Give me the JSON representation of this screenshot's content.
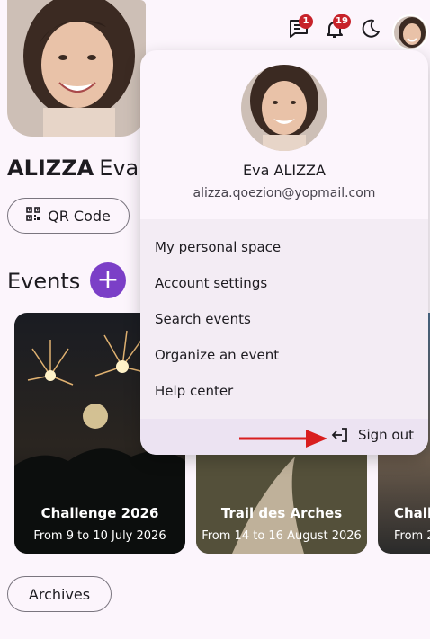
{
  "profile": {
    "last_name": "ALIZZA",
    "first_name": "Eva"
  },
  "qr_button": {
    "label": "QR Code"
  },
  "events": {
    "title": "Events",
    "add_label": "+",
    "cards": [
      {
        "title": "Challenge 2026",
        "date": "From 9 to 10 July 2026"
      },
      {
        "title": "Trail des Arches",
        "date": "From 14 to 16 August 2026"
      },
      {
        "title": "Chall",
        "date": "From 2"
      }
    ]
  },
  "archives_button": {
    "label": "Archives"
  },
  "topbar": {
    "messages_badge": "1",
    "notifications_badge": "19"
  },
  "menu": {
    "user_name": "Eva ALIZZA",
    "email": "alizza.qoezion@yopmail.com",
    "items": [
      "My personal space",
      "Account settings",
      "Search events",
      "Organize an event",
      "Help center"
    ],
    "sign_out": "Sign out"
  },
  "colors": {
    "accent": "#7b3fc7",
    "badge": "#c7222a",
    "annotation_arrow": "#d91e1e"
  }
}
